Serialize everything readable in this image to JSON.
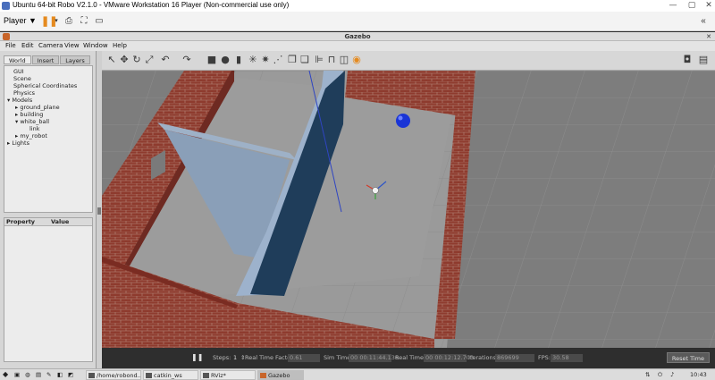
{
  "vm": {
    "title": "Ubuntu 64-bit Robo V2.1.0 - VMware Workstation 16 Player (Non-commercial use only)",
    "player_label": "Player",
    "player_caret": "▼"
  },
  "gazebo": {
    "window_title": "Gazebo",
    "menu": [
      "File",
      "Edit",
      "Camera",
      "View",
      "Window",
      "Help"
    ],
    "tabs": [
      "World",
      "Insert",
      "Layers"
    ],
    "tree": {
      "gui": "GUI",
      "scene": "Scene",
      "spherical": "Spherical Coordinates",
      "physics": "Physics",
      "models": "Models",
      "ground_plane": "ground_plane",
      "building": "building",
      "white_ball": "white_ball",
      "link": "link",
      "my_robot": "my_robot",
      "lights": "Lights"
    },
    "properties": {
      "col_property": "Property",
      "col_value": "Value"
    },
    "status": {
      "steps_label": "Steps:",
      "steps_value": "1",
      "rtf_label": "Real Time Factor:",
      "rtf_value": "0.61",
      "sim_time_label": "Sim Time:",
      "sim_time_value": "00 00:11:44.136",
      "real_time_label": "Real Time:",
      "real_time_value": "00 00:12:12.703",
      "iterations_label": "Iterations:",
      "iterations_value": "869699",
      "fps_label": "FPS:",
      "fps_value": "30.58",
      "reset_label": "Reset Time"
    }
  },
  "taskbar": {
    "tasks": [
      "/home/robond...",
      "catkin_ws",
      "RViz*",
      "Gazebo"
    ],
    "active_task": "Gazebo",
    "clock": "10:43"
  },
  "colors": {
    "ball": "#1a35d6",
    "accent_pause": "#e58a1f",
    "brick": "#8e3b2e"
  }
}
